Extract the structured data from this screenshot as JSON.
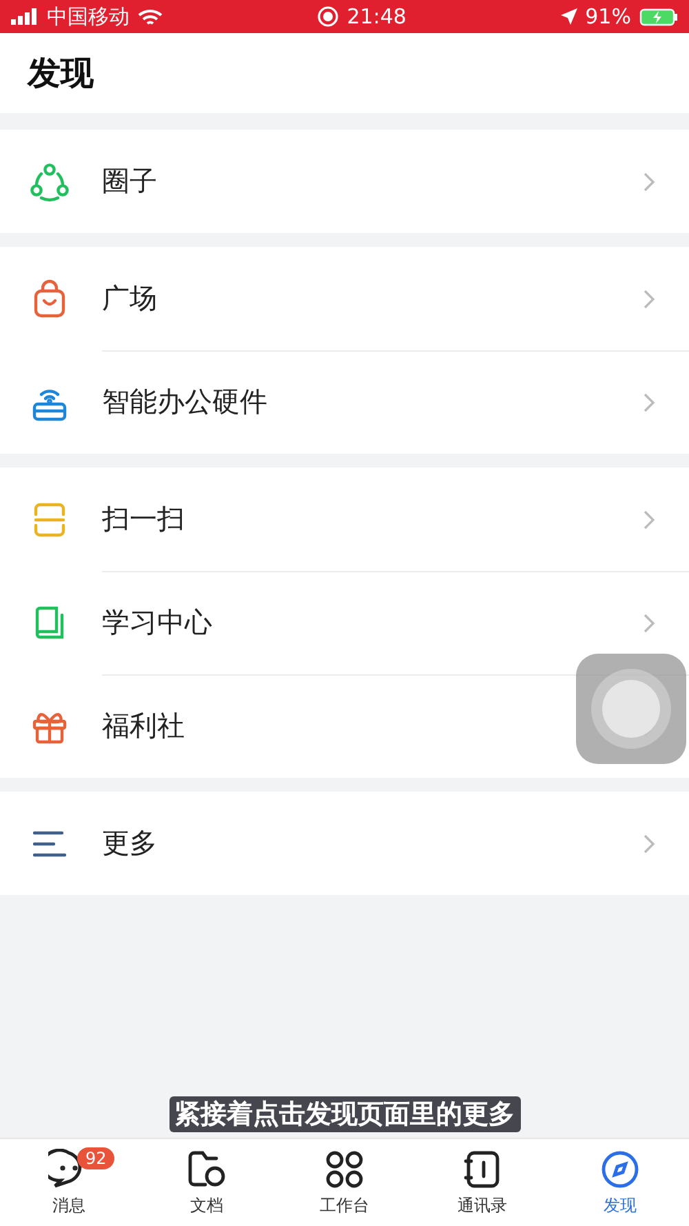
{
  "status_bar": {
    "carrier": "中国移动",
    "time": "21:48",
    "battery": "91%"
  },
  "title": "发现",
  "groups": [
    {
      "items": [
        {
          "label": "圈子"
        }
      ]
    },
    {
      "items": [
        {
          "label": "广场"
        },
        {
          "label": "智能办公硬件"
        }
      ]
    },
    {
      "items": [
        {
          "label": "扫一扫"
        },
        {
          "label": "学习中心"
        },
        {
          "label": "福利社"
        }
      ]
    },
    {
      "items": [
        {
          "label": "更多"
        }
      ]
    }
  ],
  "caption": "紧接着点击发现页面里的更多",
  "tabs": [
    {
      "label": "消息",
      "badge": "92",
      "selected": false
    },
    {
      "label": "文档",
      "selected": false
    },
    {
      "label": "工作台",
      "selected": false
    },
    {
      "label": "通讯录",
      "selected": false
    },
    {
      "label": "发现",
      "selected": true
    }
  ]
}
